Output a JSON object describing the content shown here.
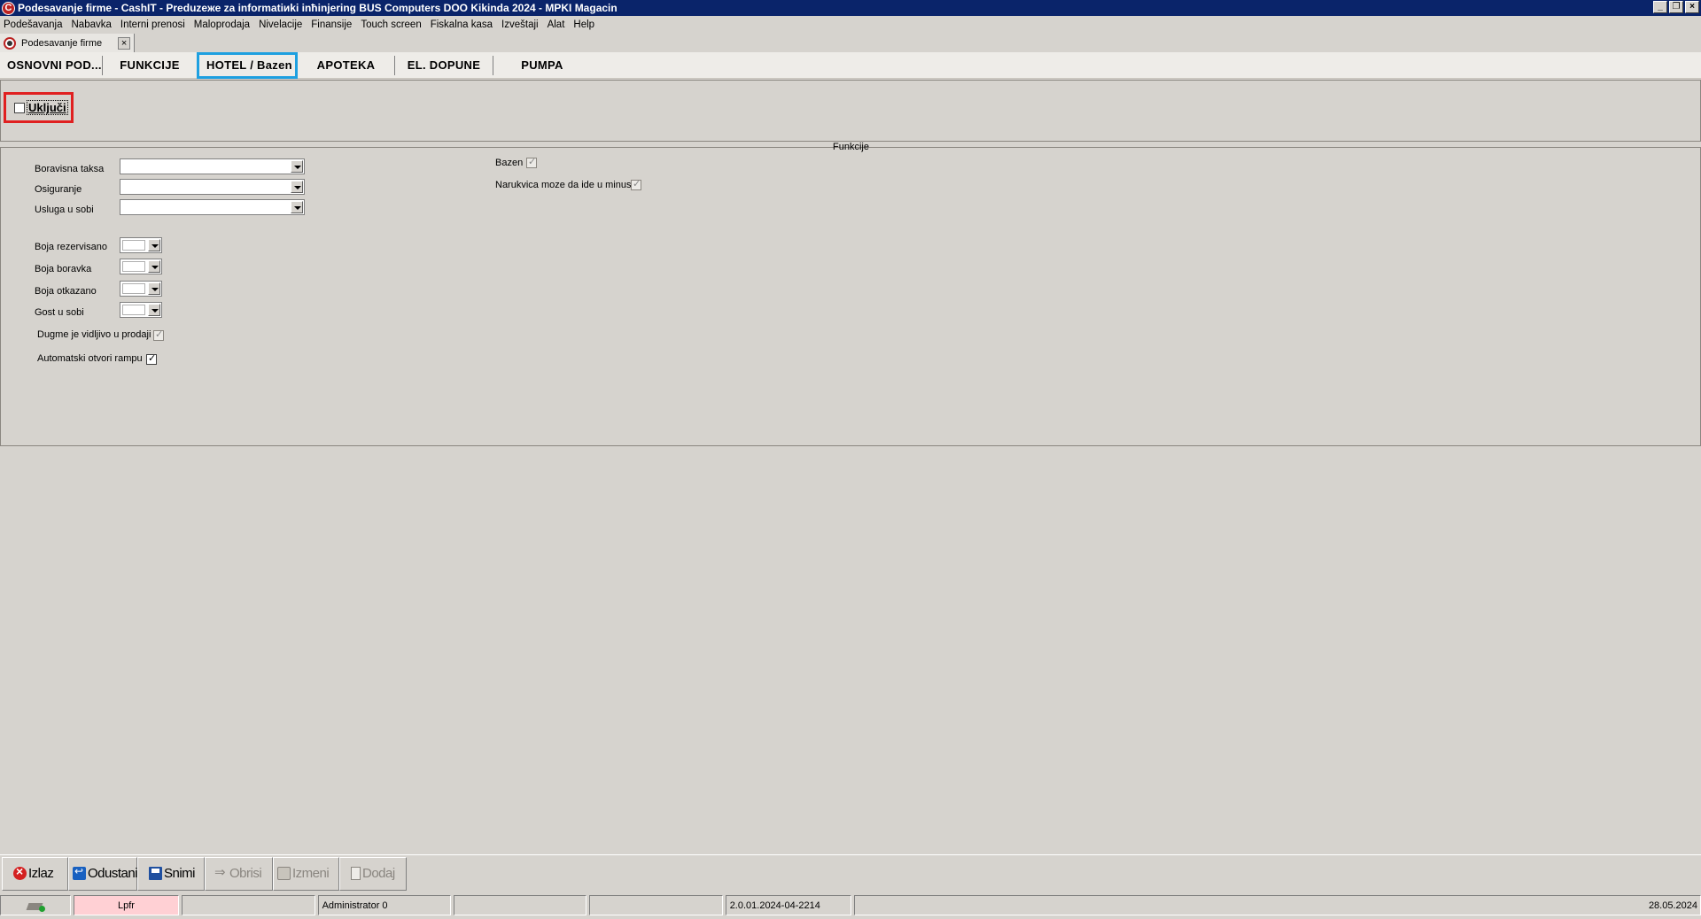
{
  "window": {
    "title": "Podesavanje firme - CashIT - Preduzeжe za informatiиki inћinjering BUS Computers DOO Kikinda 2024 - MPKI Magacin",
    "logo_letter": "C",
    "minimize": "_",
    "restore": "❐",
    "close": "×"
  },
  "menu": [
    "Podešavanja",
    "Nabavka",
    "Interni prenosi",
    "Maloprodaja",
    "Nivelacije",
    "Finansije",
    "Touch screen",
    "Fiskalna kasa",
    "Izveštaji",
    "Alat",
    "Help"
  ],
  "doc_tab": {
    "label": "Podesavanje firme",
    "close": "×"
  },
  "section_tabs": [
    "OSNOVNI POD...",
    "FUNKCIJE",
    "HOTEL / Bazen",
    "APOTEKA",
    "EL. DOPUNE",
    "PUMPA"
  ],
  "active_section_tab": "HOTEL / Bazen",
  "enable": {
    "label": "Uključi",
    "checked": false
  },
  "funkcije": {
    "group_title": "Funkcije",
    "boravisna_taksa": {
      "label": "Boravisna taksa",
      "value": ""
    },
    "osiguranje": {
      "label": "Osiguranje",
      "value": ""
    },
    "usluga_u_sobi": {
      "label": "Usluga u sobi",
      "value": ""
    },
    "boja_rezervisano": {
      "label": "Boja rezervisano",
      "color": "#ffffff"
    },
    "boja_boravka": {
      "label": "Boja boravka",
      "color": "#ffffff"
    },
    "boja_otkazano": {
      "label": "Boja otkazano",
      "color": "#ffffff"
    },
    "gost_u_sobi": {
      "label": "Gost u sobi",
      "color": "#ffffff"
    },
    "dugme_vidljivo": {
      "label": "Dugme je vidljivo u prodaji",
      "checked": true,
      "enabled": false
    },
    "automatski_rampa": {
      "label": "Automatski otvori rampu",
      "checked": true,
      "enabled": true
    },
    "bazen": {
      "label": "Bazen",
      "checked": true,
      "enabled": false
    },
    "narukvica": {
      "label": "Narukvica moze da ide u minus",
      "checked": true,
      "enabled": false
    }
  },
  "toolbar": {
    "izlaz": "Izlaz",
    "odustani": "Odustani",
    "snimi": "Snimi",
    "obrisi": "Obrisi",
    "izmeni": "Izmeni",
    "dodaj": "Dodaj"
  },
  "statusbar": {
    "lpfr": "Lpfr",
    "user": "Administrator 0",
    "version": "2.0.01.2024-04-2214",
    "date": "28.05.2024"
  },
  "colors": {
    "title_bar": "#0a246a",
    "active_tab_border": "#1ea0e0",
    "highlight_border": "#e02020",
    "lpfr_bg": "#ffd0d4"
  }
}
